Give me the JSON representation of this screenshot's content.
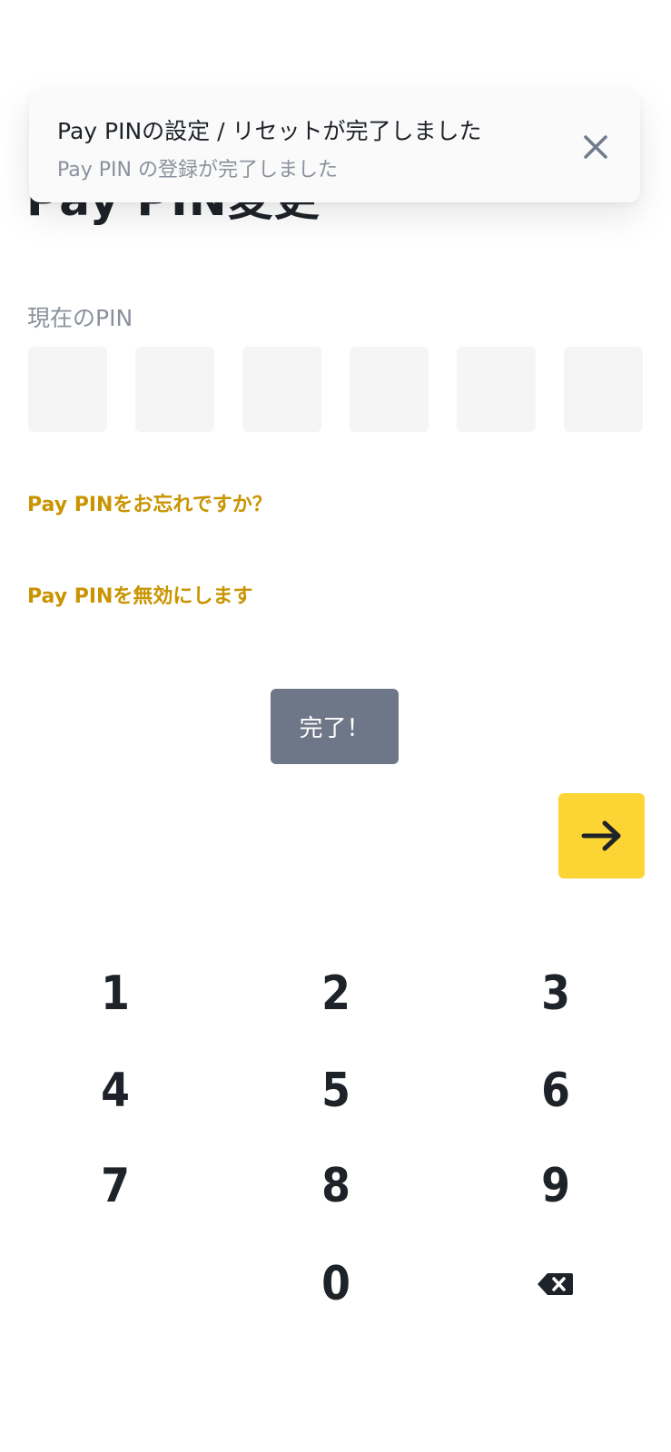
{
  "toast": {
    "title": "Pay PINの設定 / リセットが完了しました",
    "subtitle": "Pay PIN の登録が完了しました",
    "close_icon": "close-icon"
  },
  "page": {
    "title": "Pay PIN変更"
  },
  "pin": {
    "label": "現在のPIN",
    "digits": [
      "",
      "",
      "",
      "",
      "",
      ""
    ]
  },
  "links": {
    "forgot": "Pay PINをお忘れですか？",
    "disable": "Pay PINを無効にします"
  },
  "done_message": "完了！",
  "next_button": {
    "icon": "arrow-right-icon"
  },
  "keypad": {
    "keys": [
      "1",
      "2",
      "3",
      "4",
      "5",
      "6",
      "7",
      "8",
      "9",
      "0"
    ],
    "backspace_icon": "backspace-icon"
  },
  "colors": {
    "accent_yellow": "#fcd535",
    "link_gold": "#c99400",
    "text_dark": "#1e2329",
    "text_gray": "#8a919c",
    "pin_box": "#f5f5f5",
    "done_toast_bg": "#6e7787"
  }
}
